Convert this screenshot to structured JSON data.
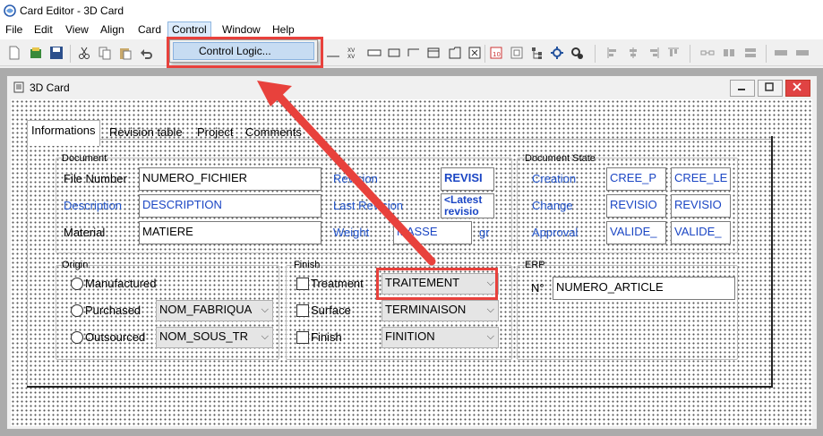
{
  "app": {
    "title": "Card Editor - 3D Card"
  },
  "menu": [
    "File",
    "Edit",
    "View",
    "Align",
    "Card",
    "Control",
    "Window",
    "Help"
  ],
  "dropdown": {
    "item": "Control Logic..."
  },
  "child": {
    "title": "3D Card"
  },
  "tabs": [
    "Informations",
    "Revision table",
    "Project",
    "Comments"
  ],
  "document": {
    "label": "Document",
    "file_number_label": "File Number",
    "file_number_value": "NUMERO_FICHIER",
    "description_label": "Description",
    "description_value": "DESCRIPTION",
    "material_label": "Material",
    "material_value": "MATIERE",
    "revision_label": "Revision",
    "revision_value": "REVISI",
    "last_revision_label": "Last Revision",
    "last_revision_value": "<Latest revisio",
    "weight_label": "Weight",
    "weight_value": "MASSE",
    "weight_unit": "gr"
  },
  "state": {
    "label": "Document State",
    "creation_label": "Creation",
    "creation_1": "CREE_P",
    "creation_2": "CREE_LE",
    "change_label": "Change",
    "change_1": "REVISIO",
    "change_2": "REVISIO",
    "approval_label": "Approval",
    "approval_1": "VALIDE_",
    "approval_2": "VALIDE_"
  },
  "origin": {
    "label": "Origin",
    "manufactured": "Manufactured",
    "purchased": "Purchased",
    "purchased_value": "NOM_FABRIQUA",
    "outsourced": "Outsourced",
    "outsourced_value": "NOM_SOUS_TR"
  },
  "finish": {
    "label": "Finish",
    "treatment": "Treatment",
    "treatment_value": "TRAITEMENT",
    "surface": "Surface",
    "surface_value": "TERMINAISON",
    "finish": "Finish",
    "finish_value": "FINITION"
  },
  "erp": {
    "label": "ERP",
    "no_label": "N°",
    "no_value": "NUMERO_ARTICLE"
  },
  "colors": {
    "highlight": "#e8413c",
    "link_label": "#2255cc"
  }
}
